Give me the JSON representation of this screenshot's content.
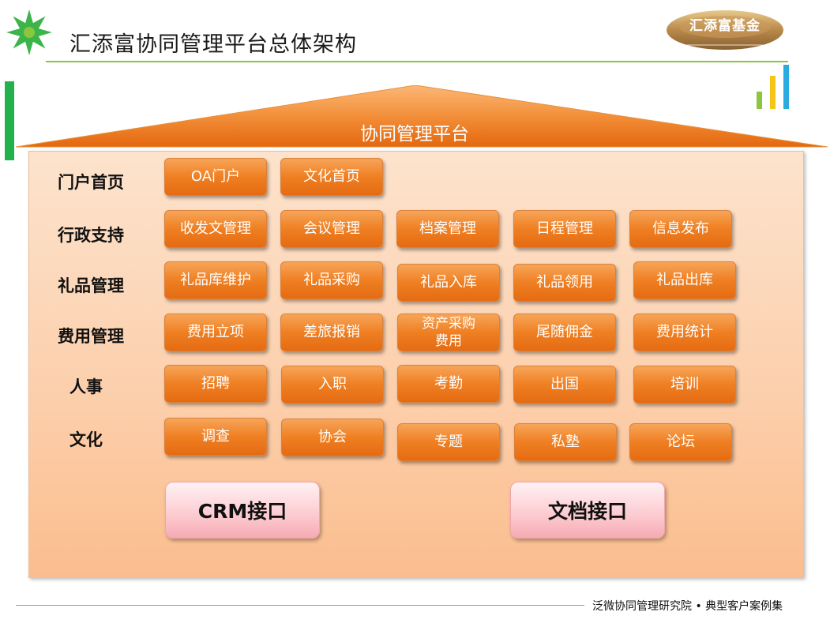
{
  "title": "汇添富协同管理平台总体架构",
  "brand": {
    "name": "汇添富基金"
  },
  "platform_label": "协同管理平台",
  "rows": [
    {
      "label": "门户首页",
      "items": [
        "OA门户",
        "文化首页"
      ]
    },
    {
      "label": "行政支持",
      "items": [
        "收发文管理",
        "会议管理",
        "档案管理",
        "日程管理",
        "信息发布"
      ]
    },
    {
      "label": "礼品管理",
      "items": [
        "礼品库维护",
        "礼品采购",
        "礼品入库",
        "礼品领用",
        "礼品出库"
      ]
    },
    {
      "label": "费用管理",
      "items": [
        "费用立项",
        "差旅报销",
        "资产采购费用",
        "尾随佣金",
        "费用统计"
      ]
    },
    {
      "label": "人事",
      "items": [
        "招聘",
        "入职",
        "考勤",
        "出国",
        "培训"
      ]
    },
    {
      "label": "文化",
      "items": [
        "调查",
        "协会",
        "专题",
        "私塾",
        "论坛"
      ]
    }
  ],
  "interfaces": [
    "CRM接口",
    "文档接口"
  ],
  "footer": "泛微协同管理研究院 • 典型客户案例集",
  "icons": {
    "logo": "green-star-logo-icon",
    "brand": "brand-emblem-icon",
    "bars": "bar-chart-icon"
  },
  "colors": {
    "accent_green": "#8cc63f",
    "left_bar": "#22b14c",
    "button_orange": "#ef7f22",
    "panel_peach": "#fcd0ad",
    "interface_pink": "#fccad0"
  }
}
